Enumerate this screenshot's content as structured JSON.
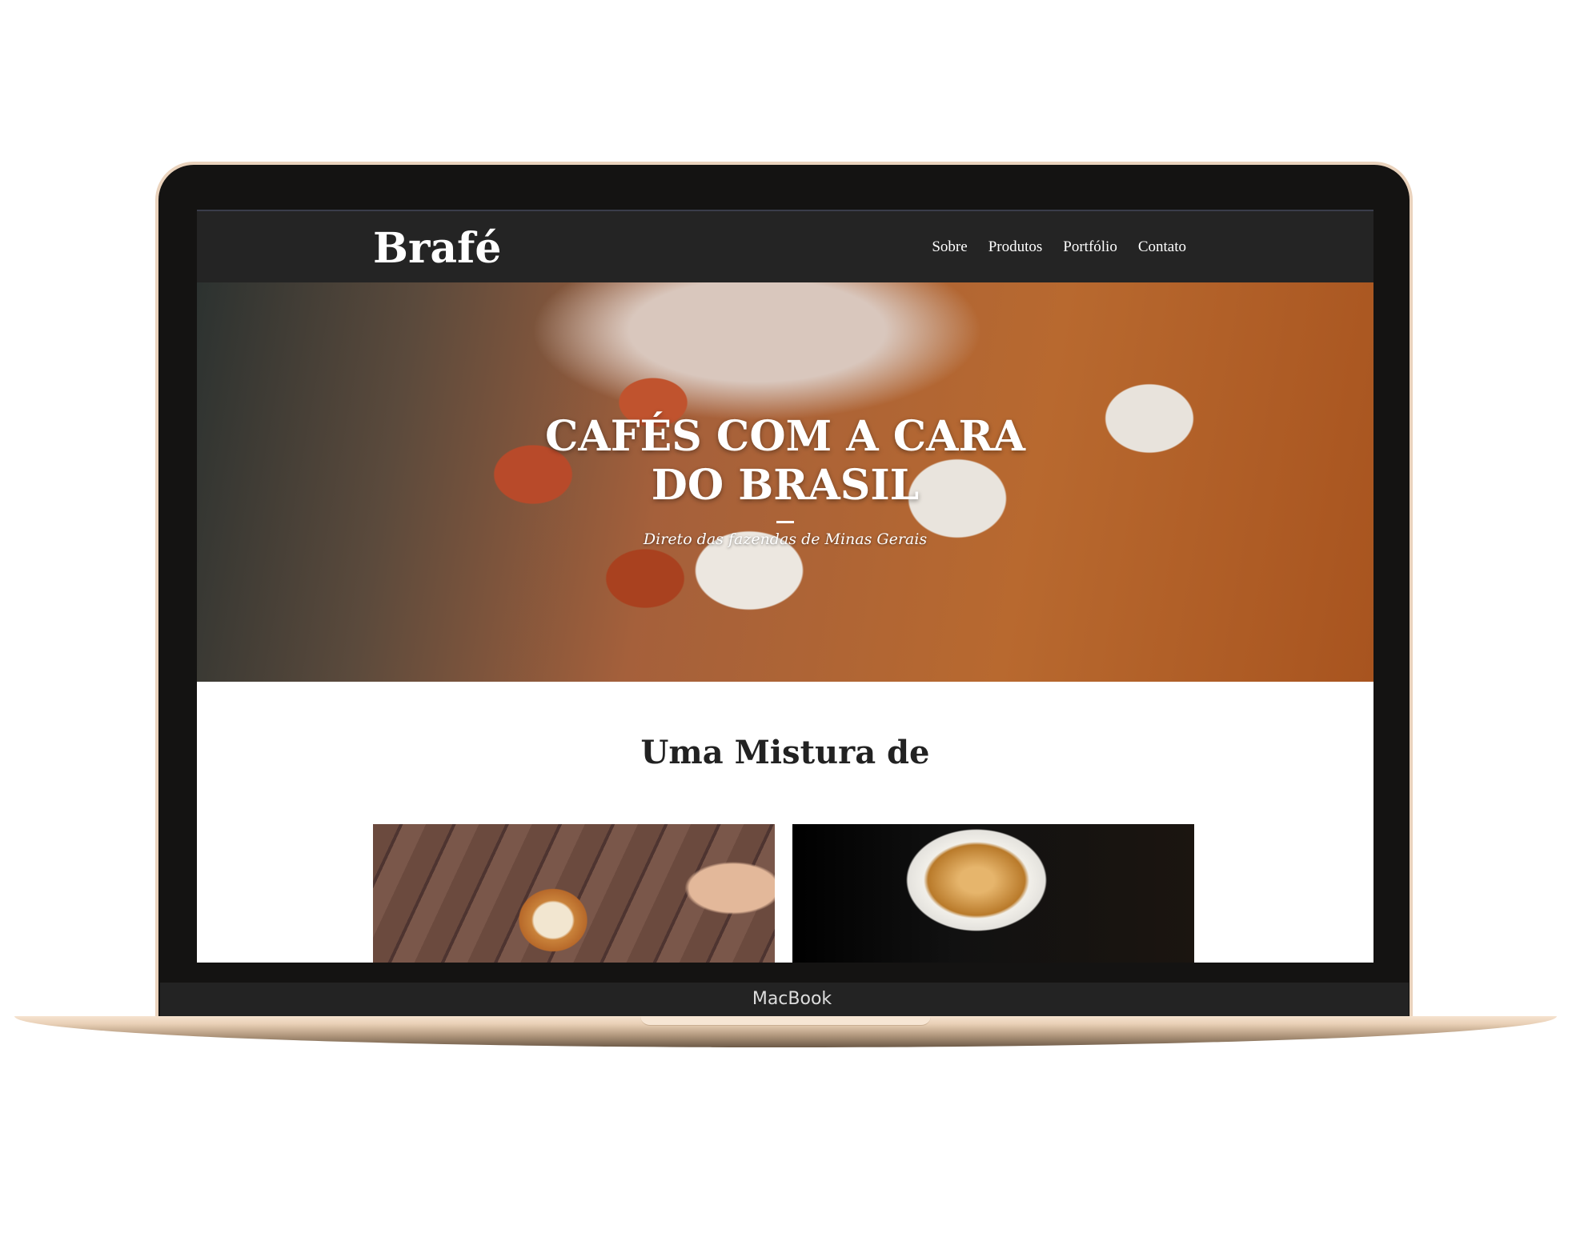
{
  "site": {
    "logo": "Brafé",
    "nav": [
      {
        "label": "Sobre"
      },
      {
        "label": "Produtos"
      },
      {
        "label": "Portfólio"
      },
      {
        "label": "Contato"
      }
    ],
    "hero": {
      "title_line1": "CAFÉS COM A CARA",
      "title_line2": "DO BRASIL",
      "subtitle": "Direto das fazendas de Minas Gerais"
    },
    "section_title": "Uma Mistura de"
  },
  "device": {
    "label": "MacBook"
  }
}
